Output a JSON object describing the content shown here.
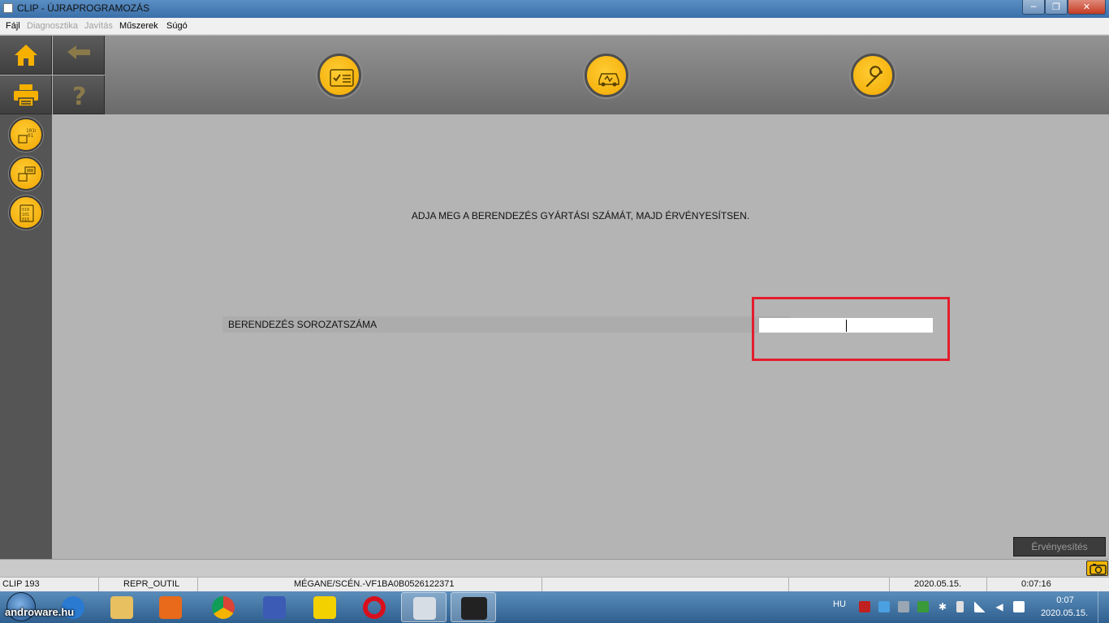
{
  "window": {
    "title": "CLIP - ÚJRAPROGRAMOZÁS",
    "min": "─",
    "max": "❐",
    "close": "✕"
  },
  "menu": [
    {
      "label": "Fájl",
      "enabled": true
    },
    {
      "label": "Diagnosztika",
      "enabled": false
    },
    {
      "label": "Javítás",
      "enabled": false
    },
    {
      "label": "Műszerek",
      "enabled": true
    },
    {
      "label": "Súgó",
      "enabled": true
    }
  ],
  "main": {
    "instruction": "ADJA MEG A BERENDEZÉS GYÁRTÁSI SZÁMÁT, MAJD ÉRVÉNYESÍTSEN.",
    "serial_label": "BERENDEZÉS SOROZATSZÁMA",
    "serial_value": "",
    "validate_label": "Érvényesítés",
    "highlight_color": "#e41d2c"
  },
  "status": {
    "clip": "CLIP 193",
    "module": "REPR_OUTIL",
    "vehicle": "MÉGANE/SCÉN.-VF1BA0B0526122371",
    "date": "2020.05.15.",
    "elapsed": "0:07:16"
  },
  "taskbar": {
    "watermark": "androware.hu",
    "language": "HU",
    "time": "0:07",
    "date": "2020.05.15.",
    "apps": [
      "internet-explorer",
      "file-explorer",
      "media-player",
      "chrome",
      "remote-app",
      "pdf-reader",
      "opera",
      "recycle-app",
      "clip-app"
    ]
  },
  "colors": {
    "accent_yellow": "#f2a900",
    "header_gray": "#6b6b6b",
    "main_bg": "#b4b4b4"
  }
}
